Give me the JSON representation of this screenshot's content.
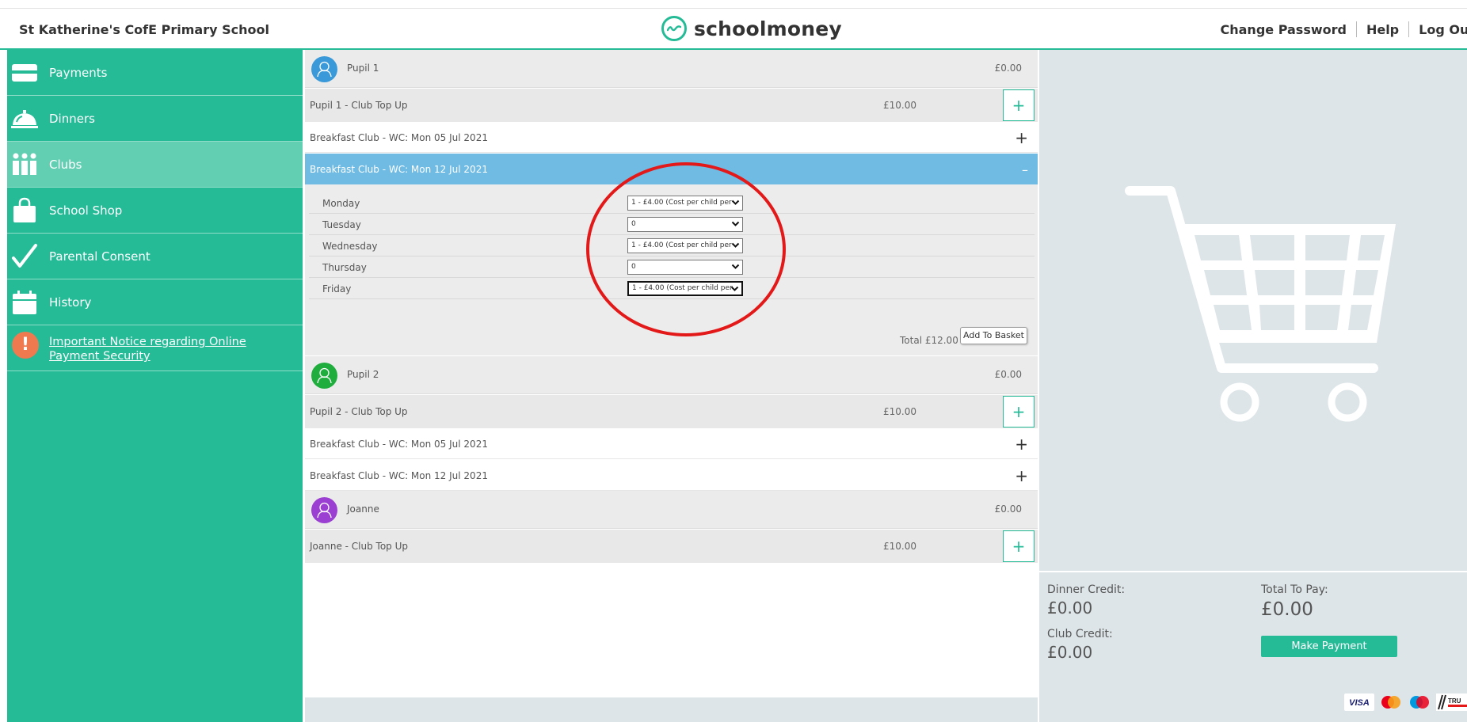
{
  "header": {
    "school_name": "St Katherine's CofE Primary School",
    "logo_text": "schoolmoney",
    "links": [
      "Change Password",
      "Help",
      "Log Out"
    ]
  },
  "sidebar": {
    "items": [
      {
        "label": "Payments",
        "icon": "card-icon"
      },
      {
        "label": "Dinners",
        "icon": "cloche-icon"
      },
      {
        "label": "Clubs",
        "icon": "people-icon",
        "active": true
      },
      {
        "label": "School Shop",
        "icon": "shopping-bag-icon"
      },
      {
        "label": "Parental Consent",
        "icon": "checkmark-icon"
      },
      {
        "label": "History",
        "icon": "calendar-icon"
      }
    ],
    "notice": "Important Notice regarding Online Payment Security"
  },
  "pupils": [
    {
      "name": "Pupil 1",
      "balance": "£0.00",
      "avatar_color": "#3a9ad9",
      "topup": {
        "label": "Pupil 1 - Club Top Up",
        "amount": "£10.00"
      },
      "clubs": [
        "Breakfast Club - WC: Mon 05 Jul 2021",
        "Breakfast Club - WC: Mon 12 Jul 2021"
      ]
    },
    {
      "name": "Pupil 2",
      "balance": "£0.00",
      "avatar_color": "#1fae3e",
      "topup": {
        "label": "Pupil 2 - Club Top Up",
        "amount": "£10.00"
      },
      "clubs": [
        "Breakfast Club - WC: Mon 05 Jul 2021",
        "Breakfast Club - WC: Mon 12 Jul 2021"
      ]
    },
    {
      "name": "Joanne",
      "balance": "£0.00",
      "avatar_color": "#9a3fd1",
      "topup": {
        "label": "Joanne - Club Top Up",
        "amount": "£10.00"
      }
    }
  ],
  "expanded_club": {
    "days": [
      {
        "day": "Monday",
        "value": "1 - £4.00 (Cost per child per"
      },
      {
        "day": "Tuesday",
        "value": "0"
      },
      {
        "day": "Wednesday",
        "value": "1 - £4.00 (Cost per child per"
      },
      {
        "day": "Thursday",
        "value": "0"
      },
      {
        "day": "Friday",
        "value": "1 - £4.00 (Cost per child per"
      }
    ],
    "total": "Total £12.00",
    "add_button": "Add To Basket"
  },
  "basket": {
    "dinner_credit_label": "Dinner Credit:",
    "dinner_credit": "£0.00",
    "club_credit_label": "Club Credit:",
    "club_credit": "£0.00",
    "total_label": "Total To Pay:",
    "total": "£0.00",
    "pay_button": "Make Payment"
  },
  "colors": {
    "accent": "#25bb97",
    "expanded_row": "#6fbbe4",
    "annotation": "#e31919"
  }
}
